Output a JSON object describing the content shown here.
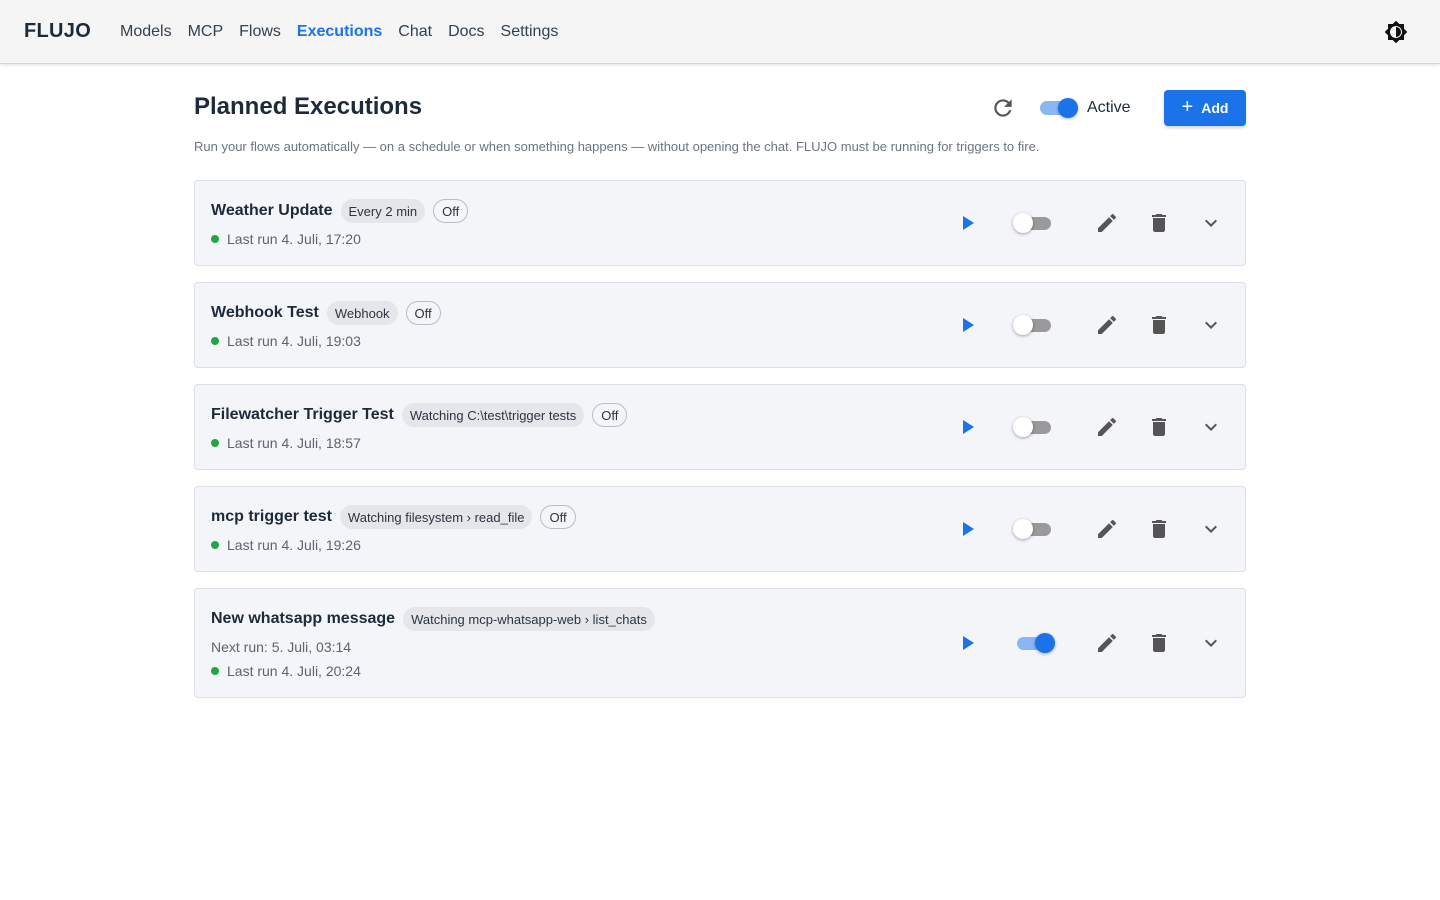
{
  "app": {
    "brand": "FLUJO"
  },
  "nav": {
    "items": [
      {
        "label": "Models"
      },
      {
        "label": "MCP"
      },
      {
        "label": "Flows"
      },
      {
        "label": "Executions",
        "active": true
      },
      {
        "label": "Chat"
      },
      {
        "label": "Docs"
      },
      {
        "label": "Settings"
      }
    ],
    "theme_icon": "brightness-icon"
  },
  "header": {
    "title": "Planned Executions",
    "active_label": "Active",
    "active_on": true,
    "add_label": "Add",
    "subtitle": "Run your flows automatically — on a schedule or when something happens — without opening the chat. FLUJO must be running for triggers to fire."
  },
  "colors": {
    "accent": "#1a73e8",
    "status_ok": "#22a447",
    "card_bg": "#f4f5f8"
  },
  "executions": [
    {
      "name": "Weather Update",
      "trigger": "Every 2 min",
      "state": "Off",
      "enabled": false,
      "next_run": "",
      "last_run": "Last run 4. Juli, 17:20"
    },
    {
      "name": "Webhook Test",
      "trigger": "Webhook",
      "state": "Off",
      "enabled": false,
      "next_run": "",
      "last_run": "Last run 4. Juli, 19:03"
    },
    {
      "name": "Filewatcher Trigger Test",
      "trigger": "Watching C:\\test\\trigger tests",
      "state": "Off",
      "enabled": false,
      "next_run": "",
      "last_run": "Last run 4. Juli, 18:57"
    },
    {
      "name": "mcp trigger test",
      "trigger": "Watching filesystem › read_file",
      "state": "Off",
      "enabled": false,
      "next_run": "",
      "last_run": "Last run 4. Juli, 19:26"
    },
    {
      "name": "New whatsapp message",
      "trigger": "Watching mcp-whatsapp-web › list_chats",
      "state": "",
      "enabled": true,
      "next_run": "Next run: 5. Juli, 03:14",
      "last_run": "Last run 4. Juli, 20:24"
    }
  ]
}
